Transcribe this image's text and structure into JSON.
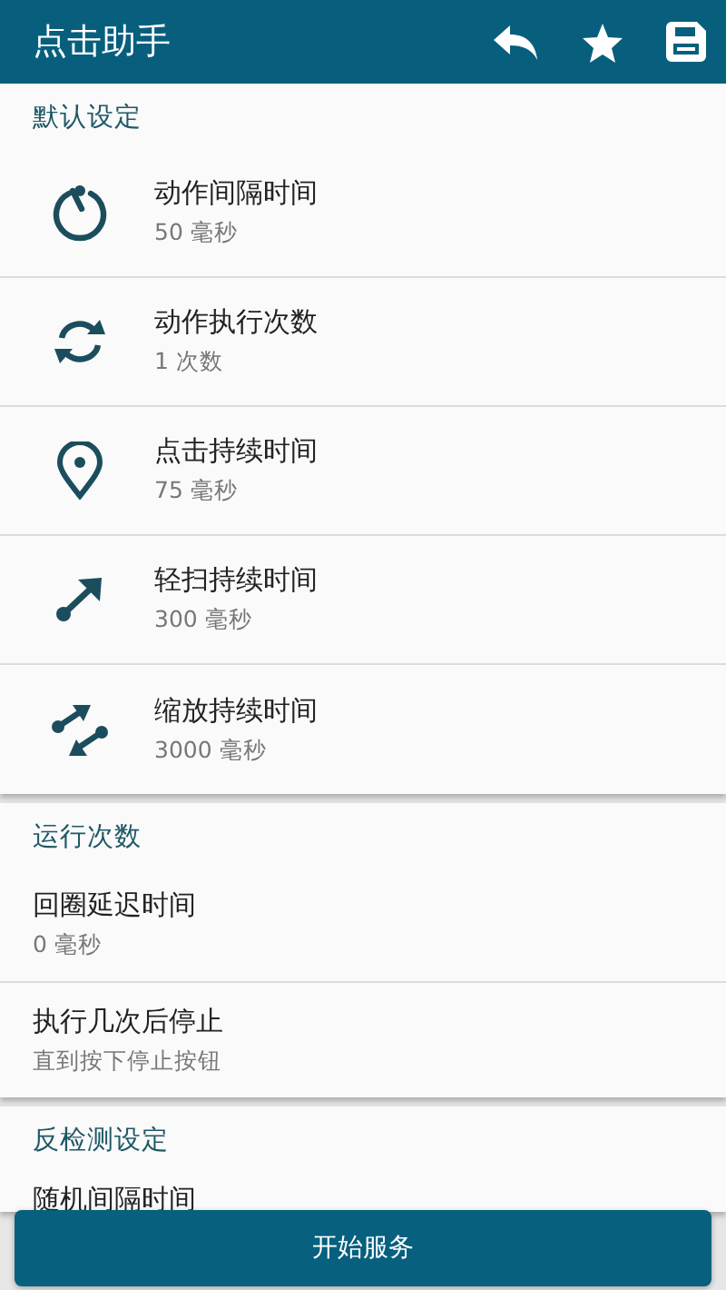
{
  "app_bar": {
    "title": "点击助手",
    "actions": [
      {
        "kind": "undo"
      },
      {
        "kind": "star"
      },
      {
        "kind": "save"
      }
    ]
  },
  "sections": [
    {
      "title": "默认设定",
      "items": [
        {
          "kind": "timer",
          "title": "动作间隔时间",
          "value": "50 毫秒"
        },
        {
          "kind": "sync",
          "title": "动作执行次数",
          "value": "1 次数"
        },
        {
          "kind": "pin",
          "title": "点击持续时间",
          "value": "75 毫秒"
        },
        {
          "kind": "swipe",
          "title": "轻扫持续时间",
          "value": "300 毫秒"
        },
        {
          "kind": "pinch",
          "title": "缩放持续时间",
          "value": "3000 毫秒"
        }
      ]
    },
    {
      "title": "运行次数",
      "items": [
        {
          "title": "回圈延迟时间",
          "value": "0 毫秒"
        },
        {
          "title": "执行几次后停止",
          "value": "直到按下停止按钮"
        }
      ]
    },
    {
      "title": "反检测设定",
      "items": [
        {
          "title": "随机间隔时间"
        }
      ]
    }
  ],
  "primary_button": "开始服务"
}
